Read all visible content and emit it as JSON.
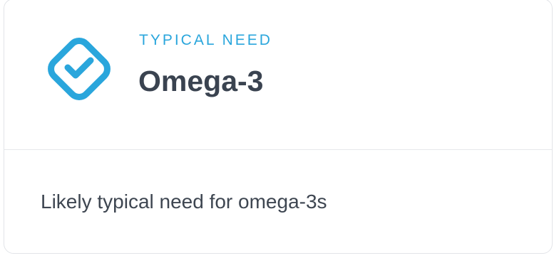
{
  "card": {
    "status_icon": "checkmark-diamond-icon",
    "eyebrow": "TYPICAL NEED",
    "title": "Omega-3",
    "description": "Likely typical need for omega-3s"
  },
  "colors": {
    "accent": "#2aa6dc",
    "title_text": "#3a4350",
    "body_text": "#3e4651",
    "border": "#e2e4e8"
  }
}
